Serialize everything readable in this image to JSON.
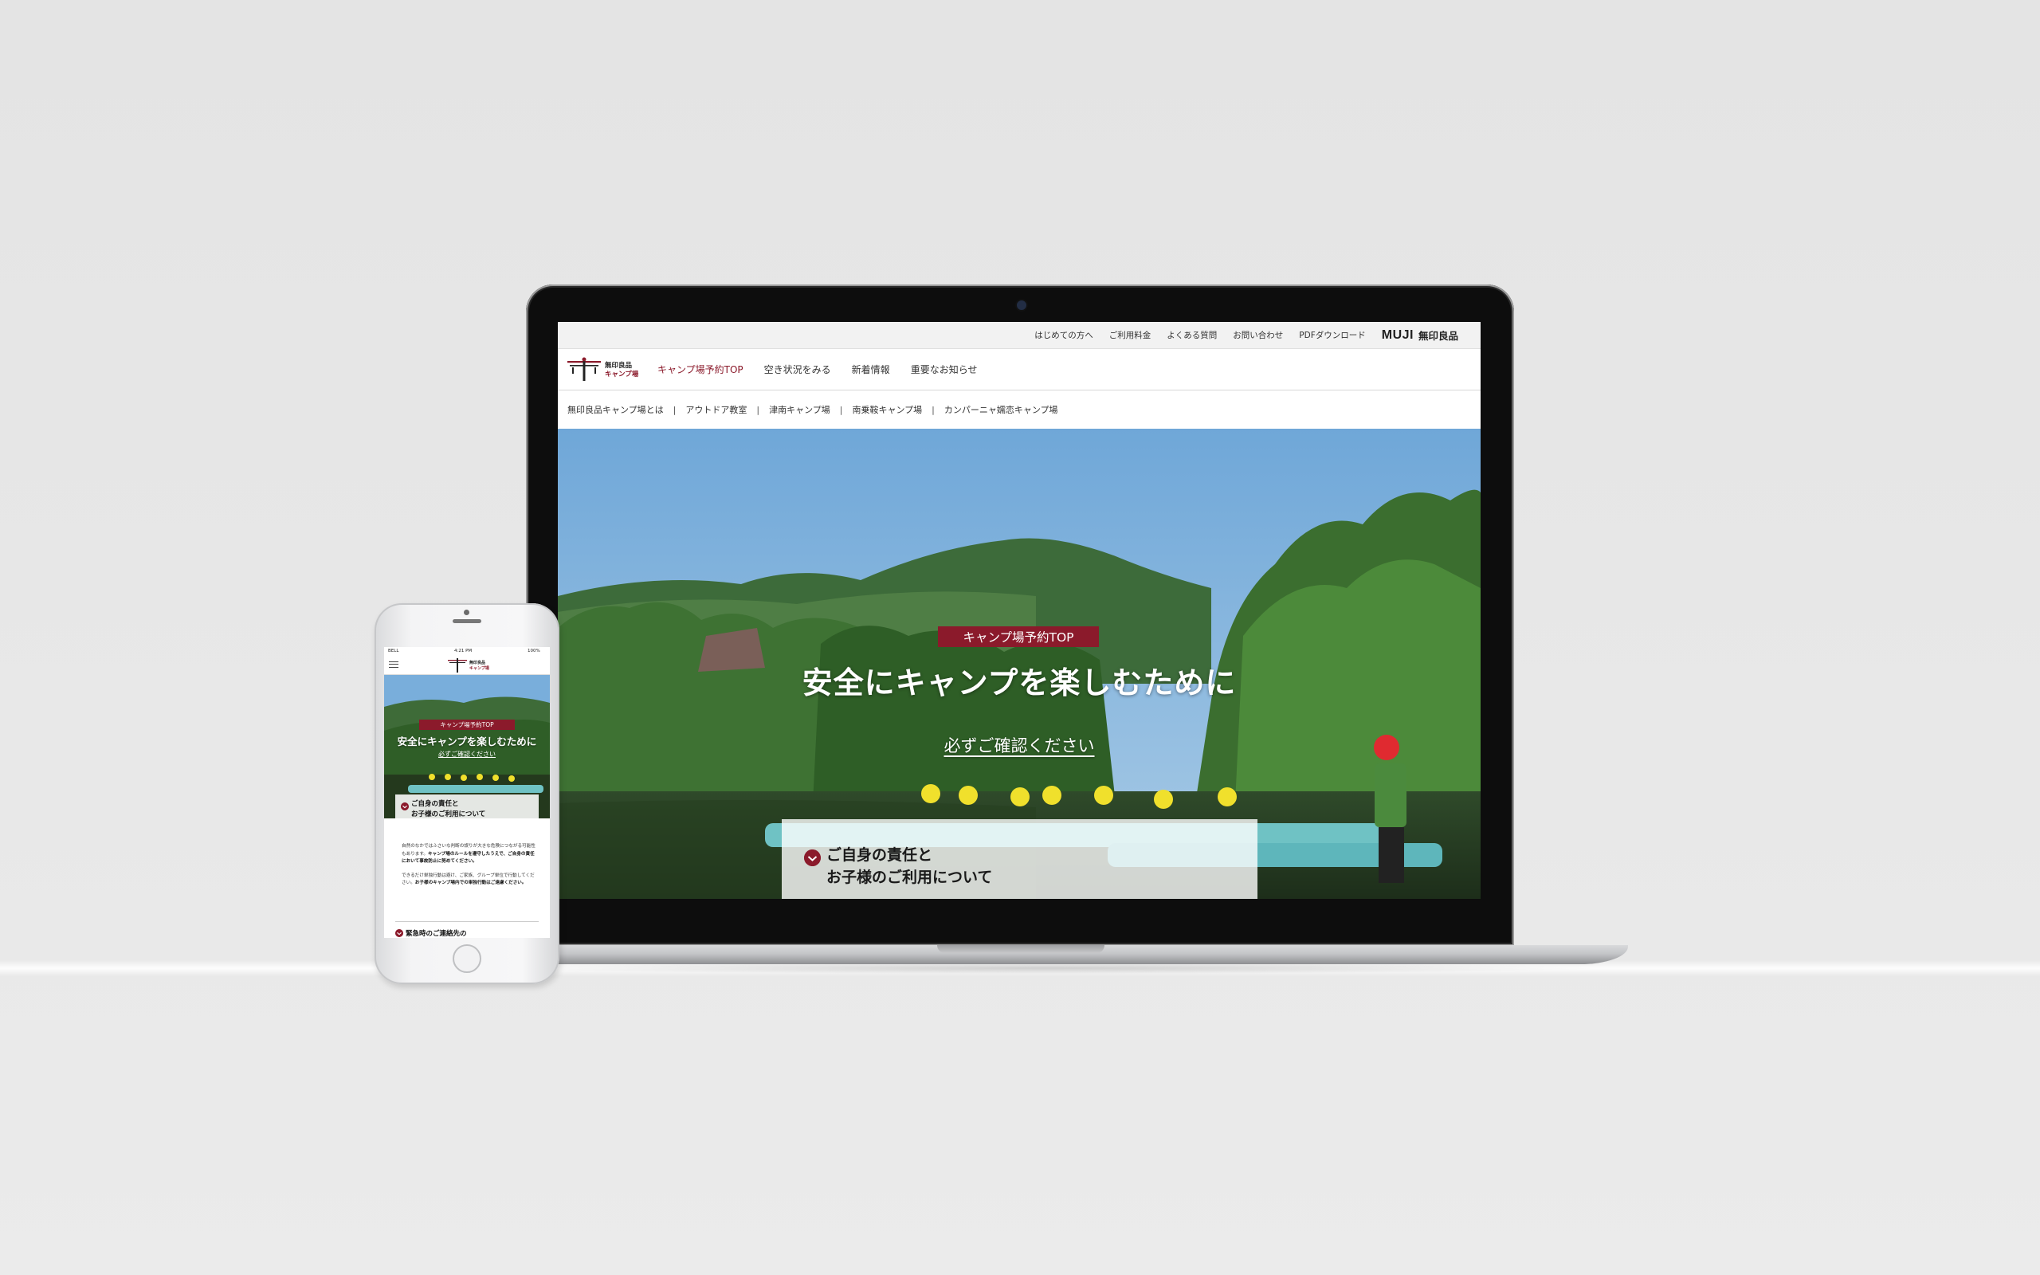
{
  "laptop": {
    "util_bar": {
      "links": [
        "はじめての方へ",
        "ご利用料金",
        "よくある質問",
        "お問い合わせ",
        "PDFダウンロード"
      ],
      "brand_en": "MUJI",
      "brand_jp": "無印良品"
    },
    "logo_text": [
      "無印良品",
      "キャンプ場"
    ],
    "nav": {
      "items": [
        "キャンプ場予約TOP",
        "空き状況をみる",
        "新着情報",
        "重要なお知らせ"
      ],
      "active_index": 0
    },
    "sub_nav": [
      "無印良品キャンプ場とは",
      "アウトドア教室",
      "津南キャンプ場",
      "南乗鞍キャンプ場",
      "カンパーニャ嬬恋キャンプ場"
    ],
    "hero": {
      "label": "キャンプ場予約TOP",
      "title": "安全にキャンプを楽しむために",
      "link": "必ずご確認ください",
      "notice": "ご自身の責任と\nお子様のご利用について"
    }
  },
  "phone": {
    "status": {
      "carrier": "BELL",
      "time": "4:21 PM",
      "battery": "100%"
    },
    "logo_text": [
      "無印良品",
      "キャンプ場"
    ],
    "hero": {
      "label": "キャンプ場予約TOP",
      "title": "安全にキャンプを楽しむために",
      "link": "必ずご確認ください",
      "notice": "ご自身の責任と\nお子様のご利用について"
    },
    "body": {
      "p1_a": "自然のなかではふさいな判断の誤りが大きな危険につながる可能性もあります。",
      "p1_b": "キャンプ場のルールを遵守したうえで、ご自身の責任において事故防止に努めてください。",
      "p2_a": "できるだけ単独行動は避け、ご家族、グループ単位で行動してください。",
      "p2_b": "お子様のキャンプ場内での単独行動はご遠慮ください。"
    },
    "section2": "緊急時のご連絡先の"
  },
  "colors": {
    "accent": "#8b1a2b",
    "background": "#e6e6e6"
  }
}
